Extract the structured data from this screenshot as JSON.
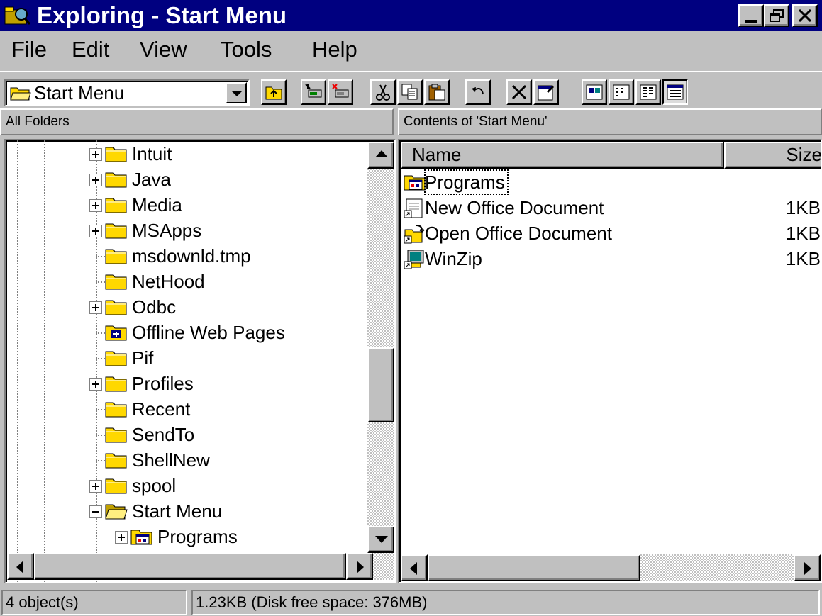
{
  "window": {
    "title": "Exploring - Start Menu"
  },
  "menu": {
    "file": "File",
    "edit": "Edit",
    "view": "View",
    "tools": "Tools",
    "help": "Help"
  },
  "toolbar": {
    "address": "Start Menu"
  },
  "headers": {
    "left": "All Folders",
    "right": "Contents of 'Start Menu'"
  },
  "tree": {
    "items": [
      {
        "label": "Intuit",
        "expandable": true,
        "icon": "folder-icon"
      },
      {
        "label": "Java",
        "expandable": true,
        "icon": "folder-icon"
      },
      {
        "label": "Media",
        "expandable": true,
        "icon": "folder-icon"
      },
      {
        "label": "MSApps",
        "expandable": true,
        "icon": "folder-icon"
      },
      {
        "label": "msdownld.tmp",
        "expandable": false,
        "icon": "folder-icon"
      },
      {
        "label": "NetHood",
        "expandable": false,
        "icon": "folder-icon"
      },
      {
        "label": "Odbc",
        "expandable": true,
        "icon": "folder-icon"
      },
      {
        "label": "Offline Web Pages",
        "expandable": false,
        "icon": "offline-web-pages-icon"
      },
      {
        "label": "Pif",
        "expandable": false,
        "icon": "folder-icon"
      },
      {
        "label": "Profiles",
        "expandable": true,
        "icon": "folder-icon"
      },
      {
        "label": "Recent",
        "expandable": false,
        "icon": "folder-icon"
      },
      {
        "label": "SendTo",
        "expandable": false,
        "icon": "folder-icon"
      },
      {
        "label": "ShellNew",
        "expandable": false,
        "icon": "folder-icon"
      },
      {
        "label": "spool",
        "expandable": true,
        "icon": "folder-icon"
      },
      {
        "label": "Start Menu",
        "expandable": "open",
        "icon": "open-folder-icon"
      },
      {
        "label": "Programs",
        "expandable": true,
        "icon": "program-group-icon",
        "sub": true
      }
    ]
  },
  "list": {
    "columns": {
      "name": "Name",
      "size": "Size"
    },
    "items": [
      {
        "name": "Programs",
        "size": "",
        "icon": "program-group-icon"
      },
      {
        "name": "New Office Document",
        "size": "1KB",
        "icon": "shortcut-icon"
      },
      {
        "name": "Open Office Document",
        "size": "1KB",
        "icon": "open-document-shortcut-icon"
      },
      {
        "name": "WinZip",
        "size": "1KB",
        "icon": "winzip-shortcut-icon"
      }
    ]
  },
  "status": {
    "objects": "4 object(s)",
    "disk": "1.23KB (Disk free space: 376MB)"
  }
}
